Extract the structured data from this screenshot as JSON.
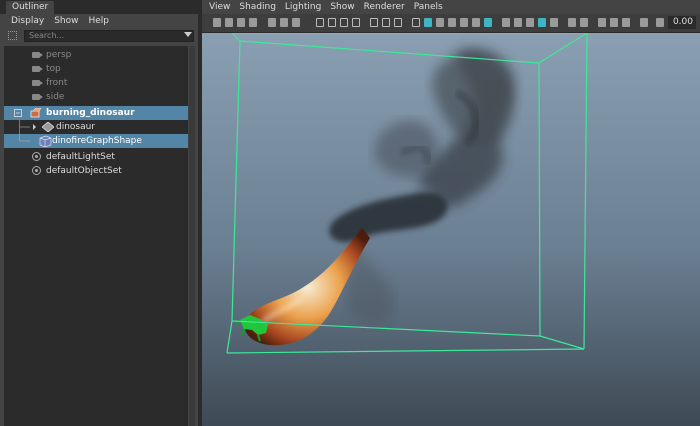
{
  "outliner": {
    "tab": "Outliner",
    "menus": [
      "Display",
      "Show",
      "Help"
    ],
    "search_placeholder": "Search...",
    "items": [
      {
        "label": "persp",
        "kind": "camera"
      },
      {
        "label": "top",
        "kind": "camera"
      },
      {
        "label": "front",
        "kind": "camera"
      },
      {
        "label": "side",
        "kind": "camera"
      },
      {
        "label": "burning_dinosaur",
        "kind": "group"
      },
      {
        "label": "dinosaur",
        "kind": "mesh"
      },
      {
        "label": "dinofireGraphShape",
        "kind": "fluid"
      },
      {
        "label": "defaultLightSet",
        "kind": "set"
      },
      {
        "label": "defaultObjectSet",
        "kind": "set"
      }
    ]
  },
  "viewport": {
    "menus": [
      "View",
      "Shading",
      "Lighting",
      "Show",
      "Renderer",
      "Panels"
    ],
    "field_value": "0.00",
    "colors": {
      "bbox": "#3ee89a",
      "bg_top": "#8a9fb2",
      "bg_bottom": "#3e4a55",
      "selection": "#5285a6"
    }
  }
}
